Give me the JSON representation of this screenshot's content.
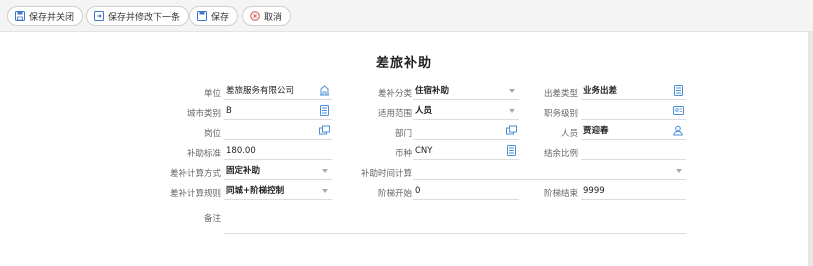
{
  "toolbar": {
    "save_close": "保存并关闭",
    "save_edit_next": "保存并修改下一条",
    "save": "保存",
    "cancel": "取消"
  },
  "form": {
    "title": "差旅补助",
    "unit": {
      "label": "单位",
      "value": "差旅服务有限公司",
      "icon": "building-icon"
    },
    "subsidy_category": {
      "label": "差补分类",
      "value": "住宿补助"
    },
    "trip_type": {
      "label": "出差类型",
      "value": "业务出差",
      "icon": "list-icon"
    },
    "city_category": {
      "label": "城市类别",
      "value": "B",
      "icon": "list-icon"
    },
    "scope": {
      "label": "适用范围",
      "value": "人员"
    },
    "job_level": {
      "label": "职务级别",
      "value": "",
      "icon": "card-icon"
    },
    "position": {
      "label": "岗位",
      "value": "",
      "icon": "org-icon"
    },
    "department": {
      "label": "部门",
      "value": "",
      "icon": "org-icon"
    },
    "person": {
      "label": "人员",
      "value": "贾迎春",
      "icon": "user-icon"
    },
    "standard": {
      "label": "补助标准",
      "value": "180.00"
    },
    "currency": {
      "label": "币种",
      "value": "CNY",
      "icon": "list-icon"
    },
    "surplus_ratio": {
      "label": "结余比例",
      "value": ""
    },
    "calc_method": {
      "label": "差补计算方式",
      "value": "固定补助"
    },
    "time_calc": {
      "label": "补助时间计算",
      "value": ""
    },
    "calc_rule": {
      "label": "差补计算规则",
      "value": "同城+阶梯控制"
    },
    "step_start": {
      "label": "阶梯开始",
      "value": "0"
    },
    "step_end": {
      "label": "阶梯结束",
      "value": "9999"
    },
    "remark": {
      "label": "备注",
      "value": ""
    }
  },
  "colors": {
    "icon_blue": "#4a90d9",
    "cancel_red": "#e05050",
    "save_blue": "#3f78c9"
  }
}
